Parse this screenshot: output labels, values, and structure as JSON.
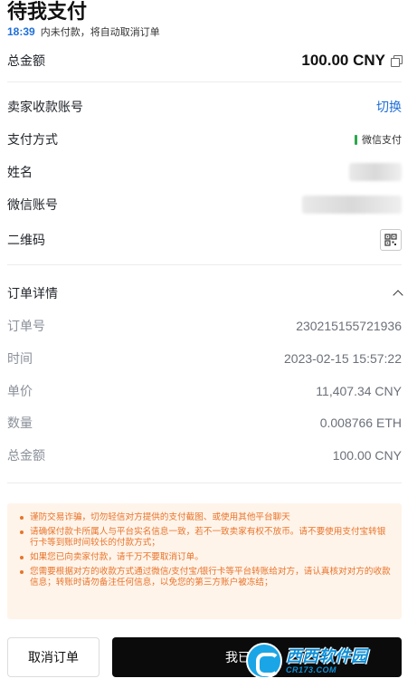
{
  "header": {
    "title": "待我支付",
    "countdown": "18:39",
    "countdown_note": "内未付款，将自动取消订单"
  },
  "summary": {
    "total_label": "总金额",
    "total_value": "100.00 CNY"
  },
  "seller": {
    "account_label": "卖家收款账号",
    "switch_label": "切换",
    "method_label": "支付方式",
    "method_value": "微信支付",
    "name_label": "姓名",
    "wechat_label": "微信账号",
    "qr_label": "二维码"
  },
  "order": {
    "section_title": "订单详情",
    "rows": [
      {
        "label": "订单号",
        "value": "230215155721936"
      },
      {
        "label": "时间",
        "value": "2023-02-15 15:57:22"
      },
      {
        "label": "单价",
        "value": "11,407.34 CNY"
      },
      {
        "label": "数量",
        "value": "0.008766 ETH"
      },
      {
        "label": "总金额",
        "value": "100.00 CNY"
      }
    ]
  },
  "notice": {
    "items": [
      "谨防交易诈骗，切勿轻信对方提供的支付截图、或使用其他平台聊天",
      "请确保付款卡所属人与平台实名信息一致，若不一致卖家有权不放币。请不要使用支付宝转银行卡等到账时间较长的付款方式；",
      "如果您已向卖家付款，请千万不要取消订单。",
      "您需要根据对方的收款方式通过微信/支付宝/银行卡等平台转账给对方，请认真核对对方的收款信息；转账时请勿备注任何信息，以免您的第三方账户被冻结；"
    ]
  },
  "actions": {
    "cancel_label": "取消订单",
    "paid_label": "我已转账，"
  },
  "watermark": {
    "main": "西西软件园",
    "sub": "CR173.COM"
  },
  "colors": {
    "accent_blue": "#1e6fd9",
    "wechat_green": "#2aa84a",
    "notice_orange": "#e8742a",
    "notice_bg": "#fff4ea",
    "primary_button": "#0b0b0b"
  }
}
